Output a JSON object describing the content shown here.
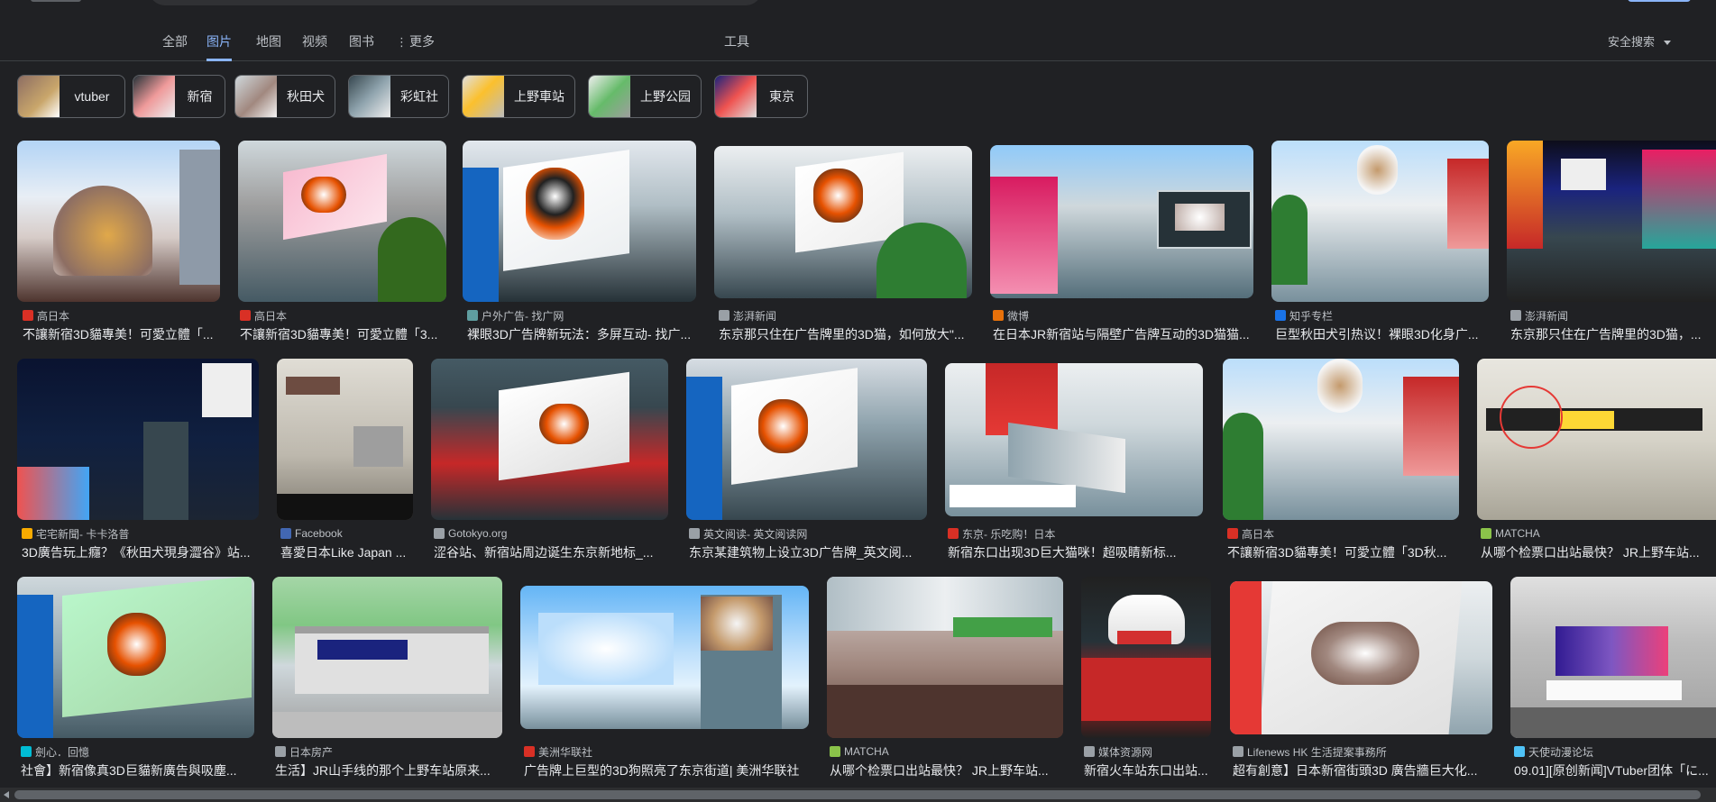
{
  "nav": {
    "tabs": [
      {
        "label": "全部",
        "active": false
      },
      {
        "label": "图片",
        "active": true
      },
      {
        "label": "地图",
        "active": false
      },
      {
        "label": "视频",
        "active": false
      },
      {
        "label": "图书",
        "active": false
      },
      {
        "label": "更多",
        "active": false
      }
    ],
    "tools": "工具",
    "safe_search": "安全搜索"
  },
  "chips": [
    {
      "label": "vtuber"
    },
    {
      "label": "新宿"
    },
    {
      "label": "秋田犬"
    },
    {
      "label": "彩虹社"
    },
    {
      "label": "上野車站"
    },
    {
      "label": "上野公园"
    },
    {
      "label": "東京"
    }
  ],
  "results": [
    {
      "source": "高日本",
      "caption": "不讓新宿3D貓專美！可愛立體「...",
      "fav": "#d93025"
    },
    {
      "source": "高日本",
      "caption": "不讓新宿3D貓專美！可愛立體「3...",
      "fav": "#d93025"
    },
    {
      "source": "户外广告- 找广网",
      "caption": "裸眼3D广告牌新玩法：多屏互动- 找广...",
      "fav": "#5f9ea0"
    },
    {
      "source": "澎湃新闻",
      "caption": "东京那只住在广告牌里的3D猫，如何放大\"...",
      "fav": "#9aa0a6"
    },
    {
      "source": "微博",
      "caption": "在日本JR新宿站与隔壁广告牌互动的3D猫猫...",
      "fav": "#e8710a"
    },
    {
      "source": "知乎专栏",
      "caption": "巨型秋田犬引热议！裸眼3D化身广...",
      "fav": "#1a73e8"
    },
    {
      "source": "澎湃新闻",
      "caption": "东京那只住在广告牌里的3D猫，...",
      "fav": "#9aa0a6"
    },
    {
      "source": "宅宅新聞- 卡卡洛普",
      "caption": "3D廣告玩上癮？《秋田犬現身澀谷》站...",
      "fav": "#f9ab00"
    },
    {
      "source": "Facebook",
      "caption": "喜愛日本Like Japan ...",
      "fav": "#4267b2"
    },
    {
      "source": "Gotokyo.org",
      "caption": "涩谷站、新宿站周边诞生东京新地标_...",
      "fav": "#9aa0a6"
    },
    {
      "source": "英文阅读- 英文阅读网",
      "caption": "东京某建筑物上设立3D广告牌_英文阅...",
      "fav": "#9aa0a6"
    },
    {
      "source": "东京- 乐吃购！日本",
      "caption": "新宿东口出现3D巨大猫咪！超吸睛新标...",
      "fav": "#d93025"
    },
    {
      "source": "高日本",
      "caption": "不讓新宿3D貓專美！可愛立體「3D秋...",
      "fav": "#d93025"
    },
    {
      "source": "MATCHA",
      "caption": "从哪个检票口出站最快？ JR上野车站...",
      "fav": "#8bc34a"
    },
    {
      "source": "劍心．回憶",
      "caption": "社會】新宿像真3D巨貓新廣告與吸塵...",
      "fav": "#00bcd4"
    },
    {
      "source": "日本房产",
      "caption": "生活】JR山手线的那个上野车站原来...",
      "fav": "#9aa0a6"
    },
    {
      "source": "美洲华联社",
      "caption": "广告牌上巨型的3D狗照亮了东京街道| 美洲华联社",
      "fav": "#d93025"
    },
    {
      "source": "MATCHA",
      "caption": "从哪个检票口出站最快？ JR上野车站...",
      "fav": "#8bc34a"
    },
    {
      "source": "媒体资源网",
      "caption": "新宿火车站东口出站...",
      "fav": "#9aa0a6"
    },
    {
      "source": "Lifenews HK 生活提案事務所",
      "caption": "超有創意】日本新宿街頭3D 廣告牆巨大化...",
      "fav": "#9aa0a6"
    },
    {
      "source": "天使动漫论坛",
      "caption": "09.01][原创新闻]VTuber团体「に...",
      "fav": "#4fc3f7"
    }
  ]
}
